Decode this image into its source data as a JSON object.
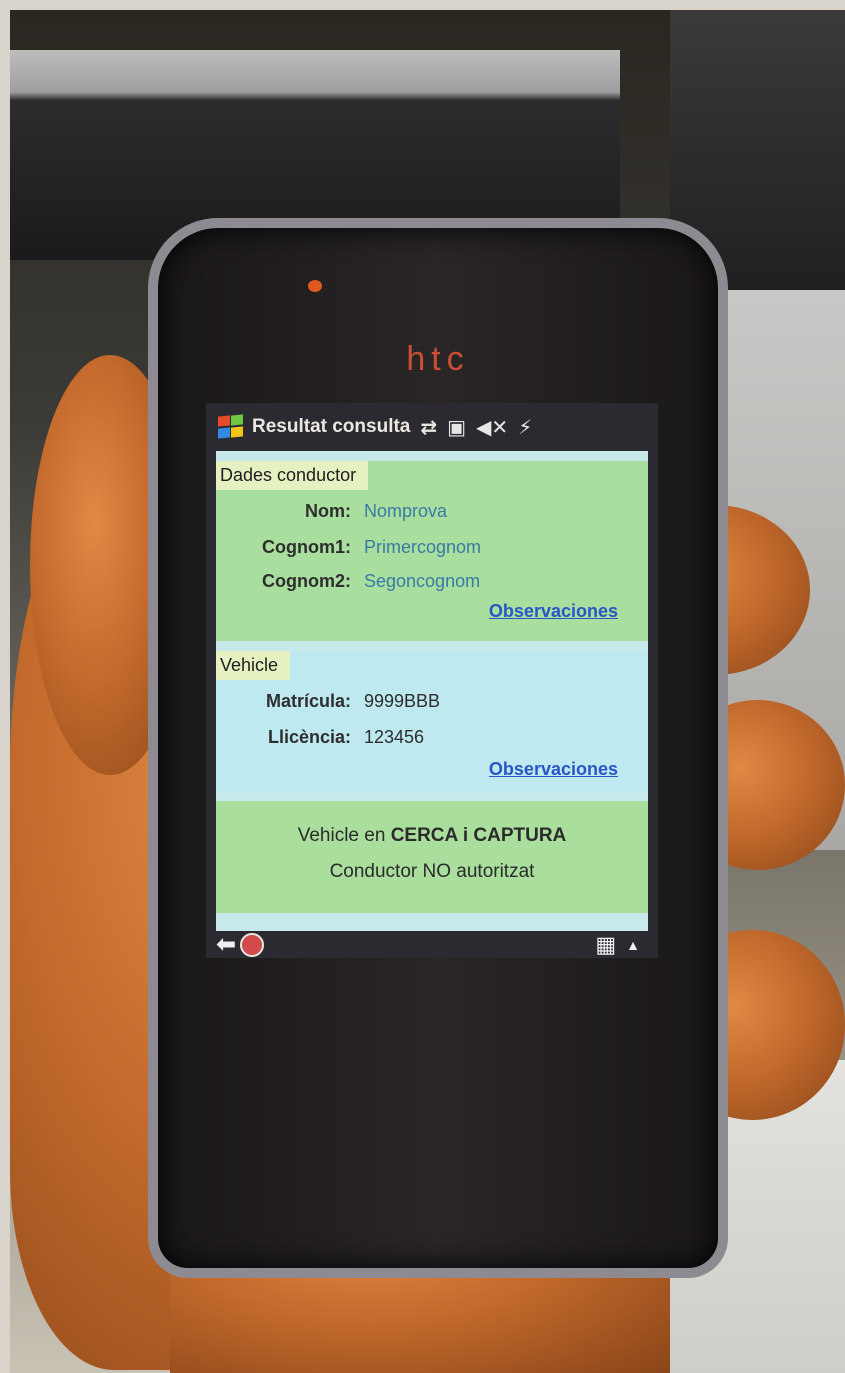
{
  "phone": {
    "brand": "htc"
  },
  "statusbar": {
    "title": "Resultat consulta",
    "icons": [
      "windows-start-icon",
      "data-transfer-icon",
      "no-sim-icon",
      "speaker-muted-icon",
      "charging-icon"
    ]
  },
  "driver_section": {
    "header": "Dades conductor",
    "name_label": "Nom:",
    "name_value": "Nomprova",
    "surname1_label": "Cognom1:",
    "surname1_value": "Primercognom",
    "surname2_label": "Cognom2:",
    "surname2_value": "Segoncognom",
    "observations_link": "Observaciones"
  },
  "vehicle_section": {
    "header": "Vehicle",
    "plate_label": "Matrícula:",
    "plate_value": "9999BBB",
    "license_label": "Llicència:",
    "license_value": "123456",
    "observations_link": "Observaciones"
  },
  "result": {
    "line1_prefix": "Vehicle en ",
    "line1_emphasis": "CERCA i CAPTURA",
    "line2": "Conductor NO autoritzat"
  },
  "softbar": {
    "icons": [
      "back-arrow-icon",
      "stop-icon",
      "keyboard-icon",
      "up-arrow-icon"
    ]
  },
  "colors": {
    "driver_bg": "#a8df9e",
    "vehicle_bg": "#bfe9f0",
    "result_bg": "#a9de9d",
    "link": "#2a56c6"
  }
}
